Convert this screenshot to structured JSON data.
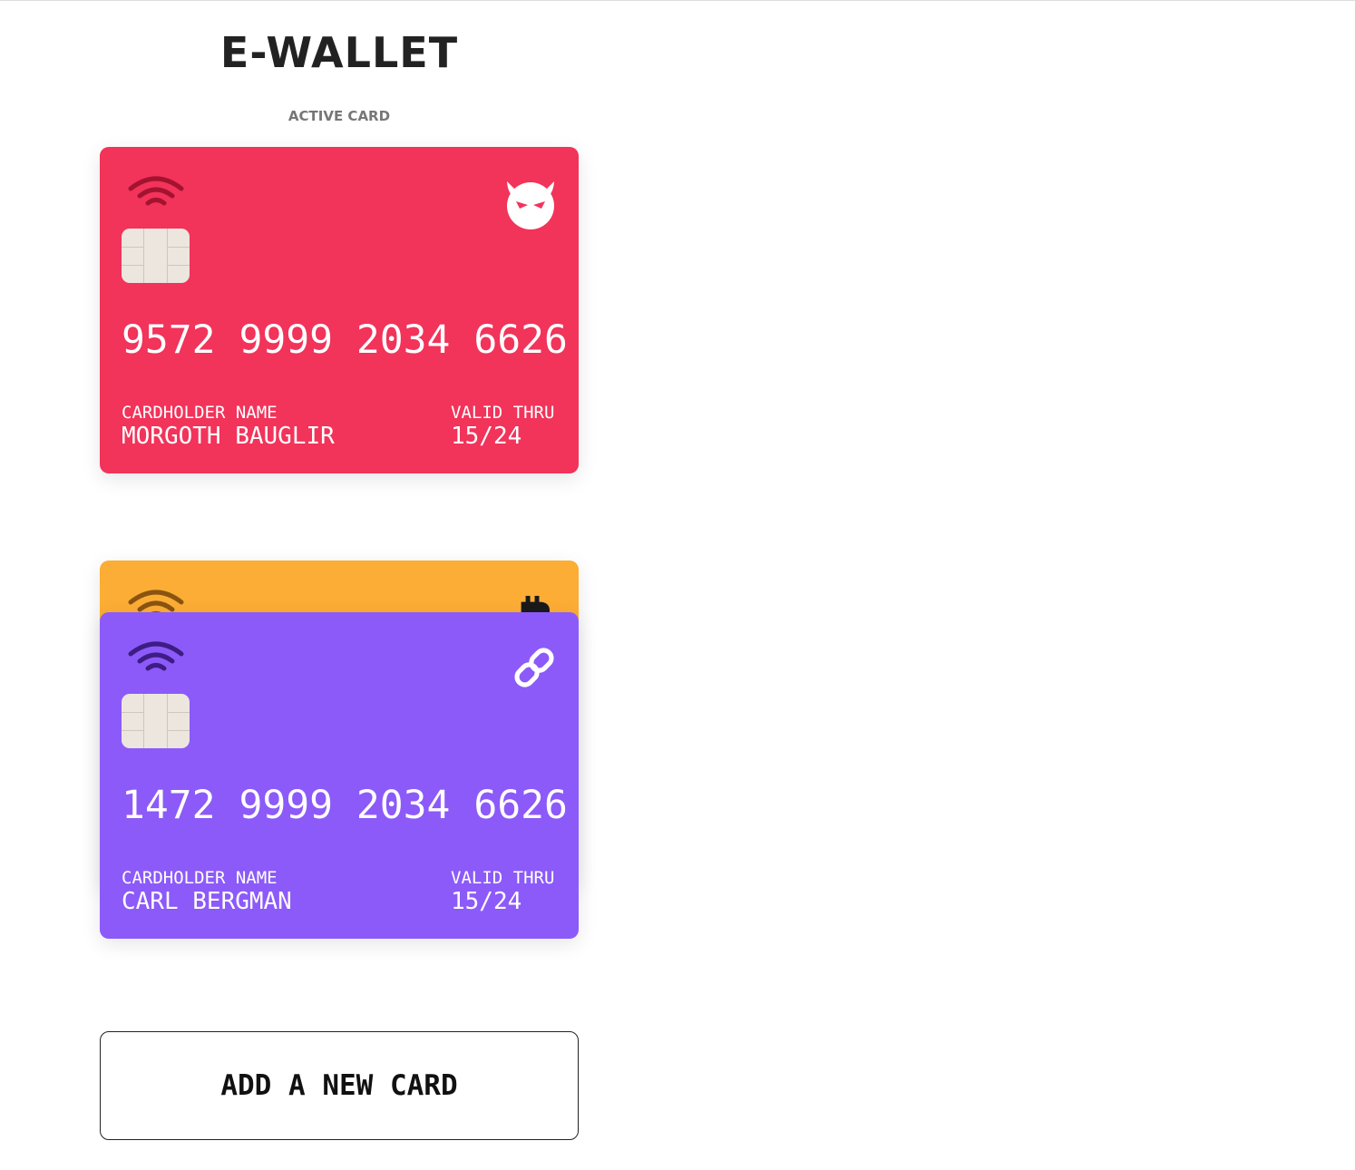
{
  "app": {
    "title": "E-WALLET",
    "active_label": "ACTIVE CARD"
  },
  "active_card": {
    "number": "9572 9999 2034 6626",
    "holder_label": "CARDHOLDER NAME",
    "holder_name": "MORGOTH BAUGLIR",
    "valid_label": "VALID THRU",
    "valid_thru": "15/24",
    "color": "#f2335a",
    "brand_icon": "evil-face-icon"
  },
  "stack": [
    {
      "color": "#fcad35",
      "brand_icon": "bitcoin-icon"
    },
    {
      "number": "1472 9999 2034 6626",
      "holder_label": "CARDHOLDER NAME",
      "holder_name": "CARL BERGMAN",
      "valid_label": "VALID THRU",
      "valid_thru": "15/24",
      "color": "#8c5af9",
      "brand_icon": "chain-link-icon"
    }
  ],
  "add_button": {
    "label": "ADD A NEW CARD"
  }
}
